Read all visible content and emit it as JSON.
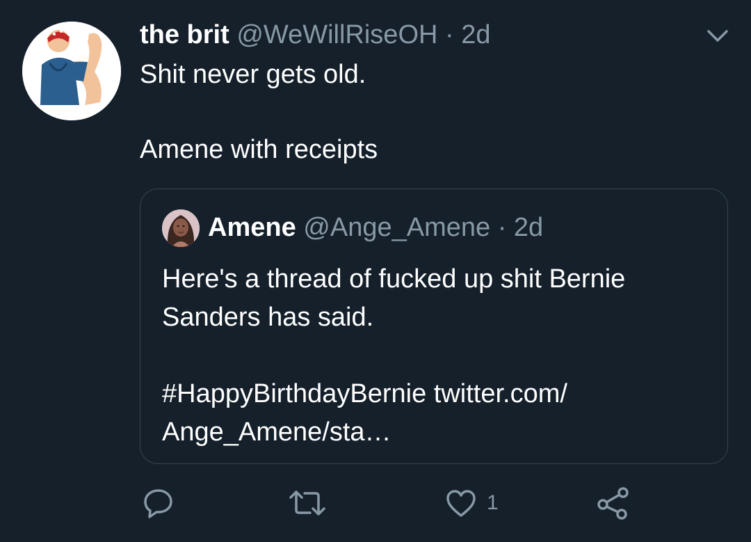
{
  "tweet": {
    "author_name": "the brit",
    "author_handle": "@WeWillRiseOH",
    "separator": "·",
    "time": "2d",
    "text_lines": [
      "Shit never gets old.",
      "Amene with receipts"
    ]
  },
  "quoted_tweet": {
    "author_name": "Amene",
    "author_handle": "@Ange_Amene",
    "separator": "·",
    "time": "2d",
    "text_lines": [
      "Here's a thread of fucked up shit Bernie",
      "Sanders has said.",
      "#HappyBirthdayBernie twitter.com/",
      "Ange_Amene/sta…"
    ]
  },
  "actions": {
    "reply_icon": "reply-icon",
    "retweet_icon": "retweet-icon",
    "like_icon": "heart-icon",
    "like_count": "1",
    "share_icon": "share-icon"
  },
  "colors": {
    "background": "#15202b",
    "text_primary": "#ffffff",
    "text_secondary": "#8899a6",
    "border": "#38444d"
  }
}
